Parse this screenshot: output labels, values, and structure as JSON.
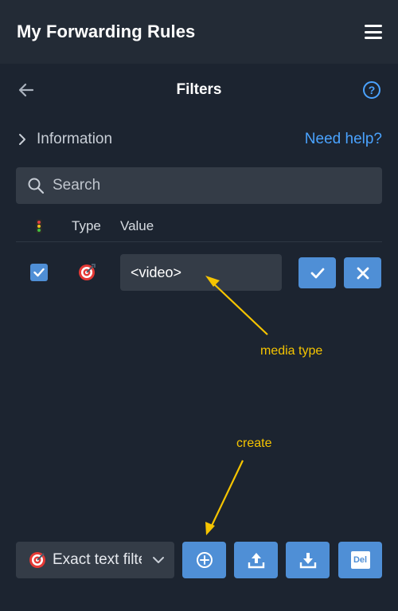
{
  "app": {
    "title": "My Forwarding Rules"
  },
  "header": {
    "title": "Filters",
    "help_glyph": "?"
  },
  "info": {
    "label": "Information",
    "help_link": "Need help?"
  },
  "search": {
    "placeholder": "Search",
    "value": ""
  },
  "table": {
    "columns": {
      "status_icon": "traffic-light-icon",
      "type": "Type",
      "value": "Value"
    },
    "rows": [
      {
        "enabled": true,
        "type_icon": "target-icon",
        "value": "<video>"
      }
    ]
  },
  "annotations": {
    "media_type": "media type",
    "create": "create"
  },
  "bottom": {
    "filter_type_label": "Exact text filter",
    "del_label": "Del"
  },
  "colors": {
    "background": "#1c2430",
    "topbar": "#232b36",
    "accent_blue": "#4f8fd6",
    "link_blue": "#4aa3ff",
    "annotation_yellow": "#f5c400",
    "field_bg": "#343c47"
  }
}
